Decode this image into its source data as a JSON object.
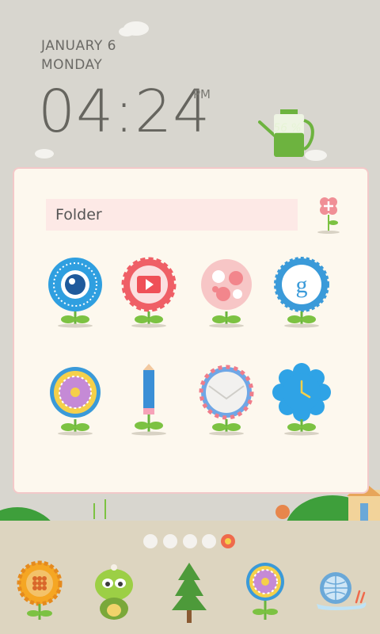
{
  "clock": {
    "date": "JANUARY 6",
    "day": "MONDAY",
    "time": "04:24",
    "ampm": "PM"
  },
  "battery": {
    "level_percent": 56,
    "label": "56 %"
  },
  "folder": {
    "name": "Folder",
    "apps": [
      {
        "icon": "camera-flower-icon"
      },
      {
        "icon": "youtube-flower-icon"
      },
      {
        "icon": "gallery-flower-icon"
      },
      {
        "icon": "google-flower-icon"
      },
      {
        "icon": "messaging-flower-icon"
      },
      {
        "icon": "pencil-flower-icon"
      },
      {
        "icon": "email-flower-icon"
      },
      {
        "icon": "clock-flower-icon"
      }
    ]
  },
  "page_indicator": {
    "pages": 5,
    "current": 5
  },
  "dock": {
    "items": [
      {
        "icon": "dialer-sunflower-icon"
      },
      {
        "icon": "turtle-contacts-icon"
      },
      {
        "icon": "tree-icon"
      },
      {
        "icon": "flower-apps-icon"
      },
      {
        "icon": "snail-browser-icon"
      }
    ]
  },
  "colors": {
    "background": "#d8d6cf",
    "folder_bg": "#fdf8ee",
    "folder_border": "#f3c9c9",
    "leaf": "#7cc242",
    "battery": "#6db33f"
  }
}
